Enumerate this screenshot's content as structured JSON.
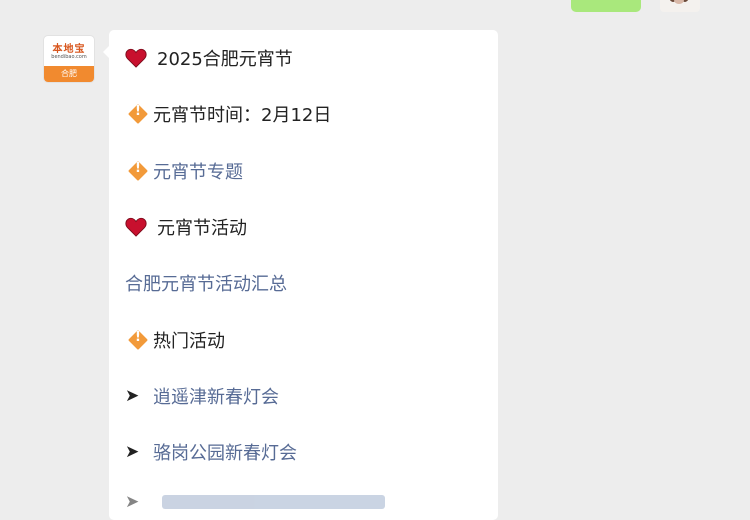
{
  "avatar": {
    "logo_text": "本地宝",
    "logo_sub": "bendibao.com",
    "city": "合肥"
  },
  "message": {
    "items": [
      {
        "icon": "heart-icon",
        "text": "2025合肥元宵节",
        "style": "plain"
      },
      {
        "icon": "diamond-icon",
        "text": "元宵节时间：2月12日",
        "style": "plain"
      },
      {
        "icon": "diamond-icon",
        "text": "元宵节专题",
        "style": "link"
      },
      {
        "icon": "heart-icon",
        "text": "元宵节活动",
        "style": "plain"
      },
      {
        "icon": "",
        "text": "合肥元宵节活动汇总",
        "style": "link"
      },
      {
        "icon": "diamond-icon",
        "text": "热门活动",
        "style": "plain"
      },
      {
        "icon": "arrow-icon",
        "text": "逍遥津新春灯会",
        "style": "link"
      },
      {
        "icon": "arrow-icon",
        "text": "骆岗公园新春灯会",
        "style": "link"
      }
    ],
    "diamond_glyph": "!",
    "arrow_glyph": "➤"
  },
  "colors": {
    "link": "#576b95",
    "heart": "#c8102e",
    "diamond": "#f29a3a",
    "sent_bubble": "#a9e87c",
    "background": "#ededed"
  }
}
